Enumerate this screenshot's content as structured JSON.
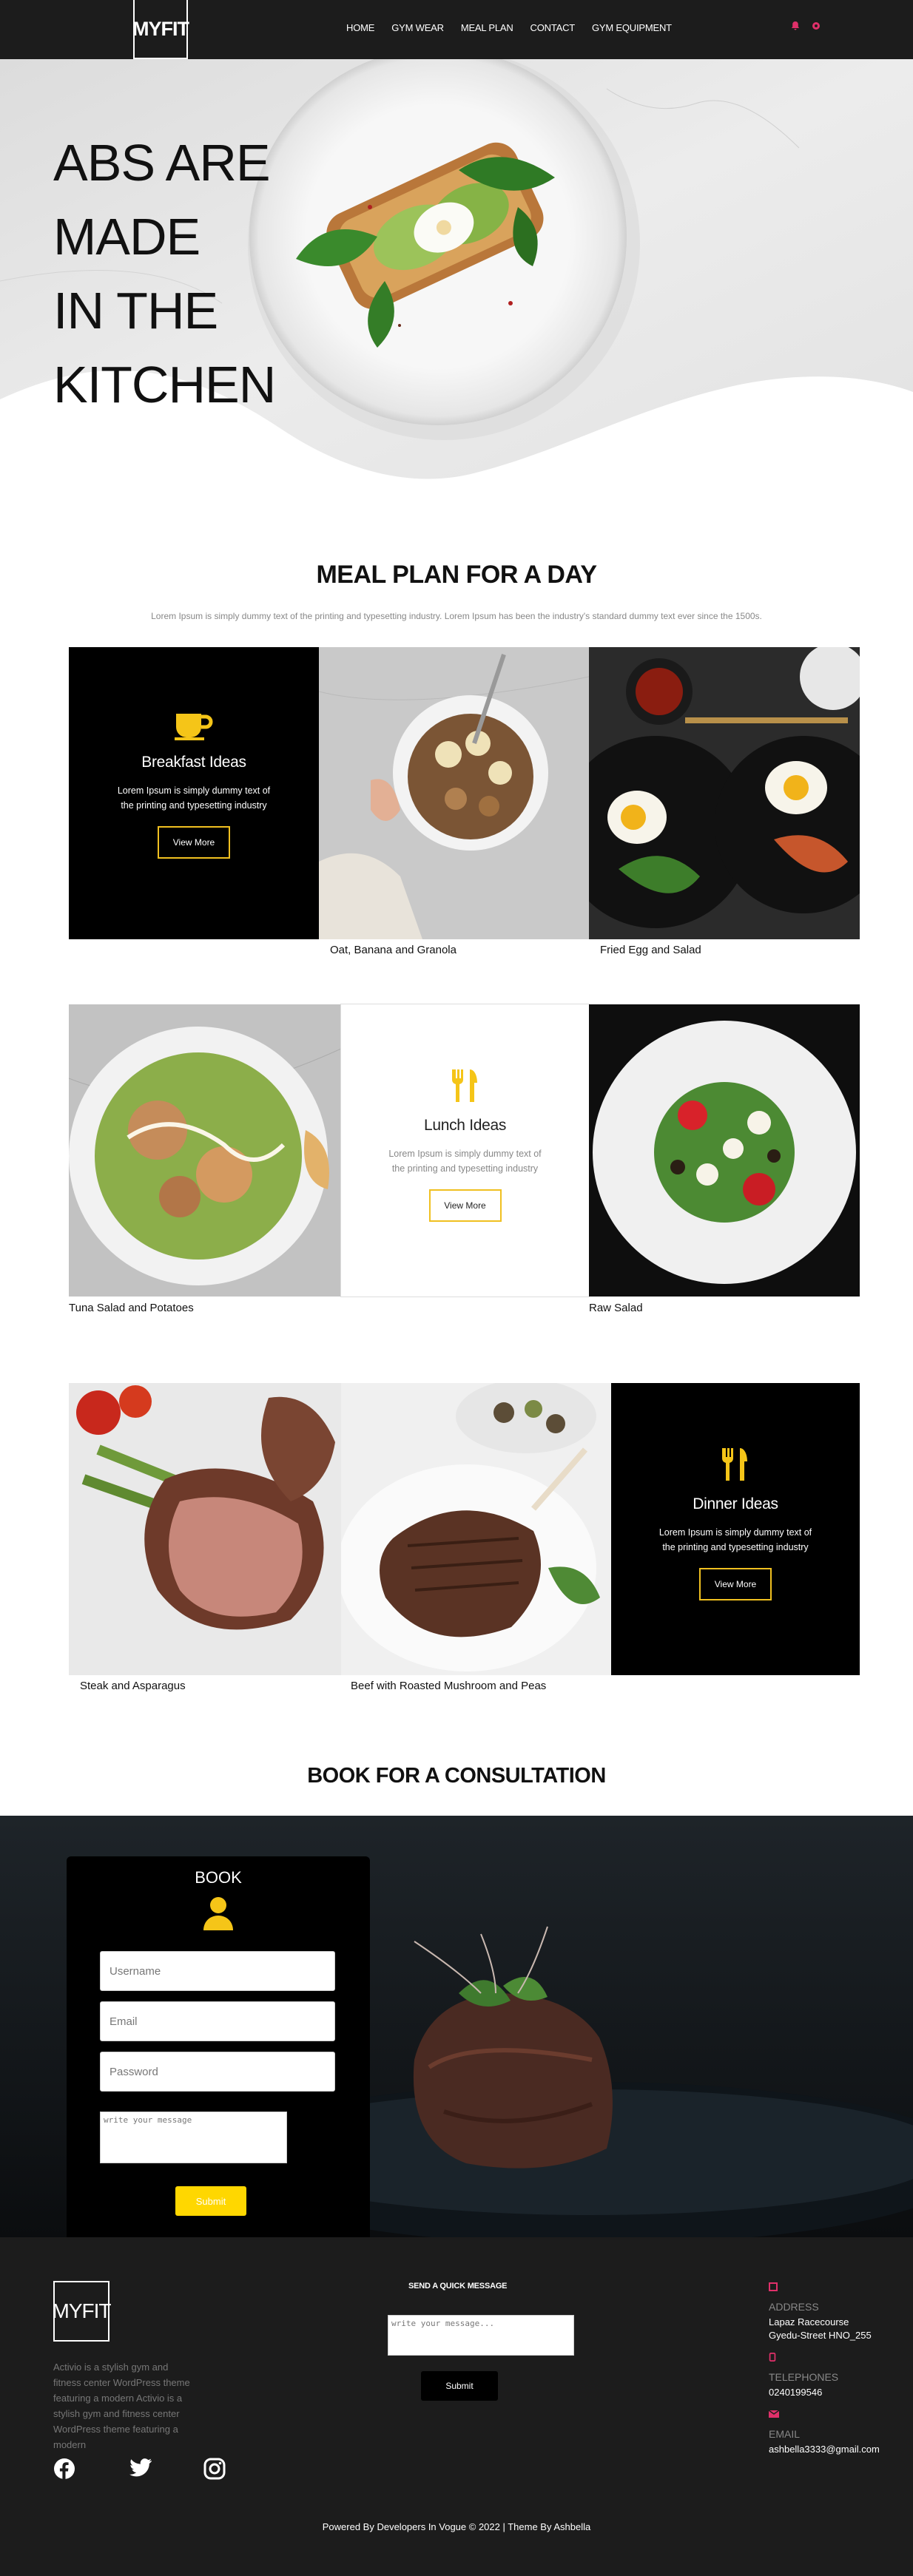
{
  "header": {
    "logo": "MYFIT",
    "nav": [
      "HOME",
      "GYM WEAR",
      "MEAL PLAN",
      "CONTACT",
      "GYM EQUIPMENT"
    ]
  },
  "hero": {
    "title_line1": "ABS ARE MADE",
    "title_line2": "IN THE KITCHEN"
  },
  "meal_plan": {
    "title": "MEAL PLAN FOR A DAY",
    "subtitle": "Lorem Ipsum is simply dummy text of the printing and typesetting industry. Lorem Ipsum has been the industry's standard dummy text ever since the 1500s.",
    "breakfast": {
      "title": "Breakfast Ideas",
      "text": "Lorem Ipsum is simply dummy text of the printing and typesetting industry",
      "button": "View More",
      "cap1": "Oat, Banana and Granola",
      "cap2": "Fried Egg and Salad"
    },
    "lunch": {
      "title": "Lunch Ideas",
      "text": "Lorem Ipsum is simply dummy text of the printing and typesetting industry",
      "button": "View More",
      "cap1": "Tuna Salad and Potatoes",
      "cap2": "Raw Salad"
    },
    "dinner": {
      "title": "Dinner Ideas",
      "text": "Lorem Ipsum is simply dummy text of the printing and typesetting industry",
      "button": "View More",
      "cap1": "Steak and Asparagus",
      "cap2": "Beef with Roasted Mushroom and Peas"
    }
  },
  "booking": {
    "title": "BOOK FOR A CONSULTATION",
    "form_title": "BOOK",
    "username_placeholder": "Username",
    "email_placeholder": "Email",
    "password_placeholder": "Password",
    "message_placeholder": "write your message",
    "submit": "Submit"
  },
  "footer": {
    "logo": "MYFIT",
    "description": "Activio is a stylish gym and fitness center WordPress theme featuring a modern Activio is a stylish gym and fitness center WordPress theme featuring a modern",
    "quick_title": "SEND A QUICK MESSAGE",
    "quick_placeholder": "write your message...",
    "quick_submit": "Submit",
    "address_label": "ADDRESS",
    "address_line1": "Lapaz Racecourse",
    "address_line2": "Gyedu-Street HNO_255",
    "phone_label": "TELEPHONES",
    "phone": "0240199546",
    "email_label": "EMAIL",
    "email": "ashbella3333@gmail.com",
    "copyright": "Powered By Developers In Vogue © 2022 | Theme By Ashbella"
  },
  "colors": {
    "accent": "#f5c518",
    "dark": "#1c1c1c",
    "pink": "#e0306a"
  }
}
